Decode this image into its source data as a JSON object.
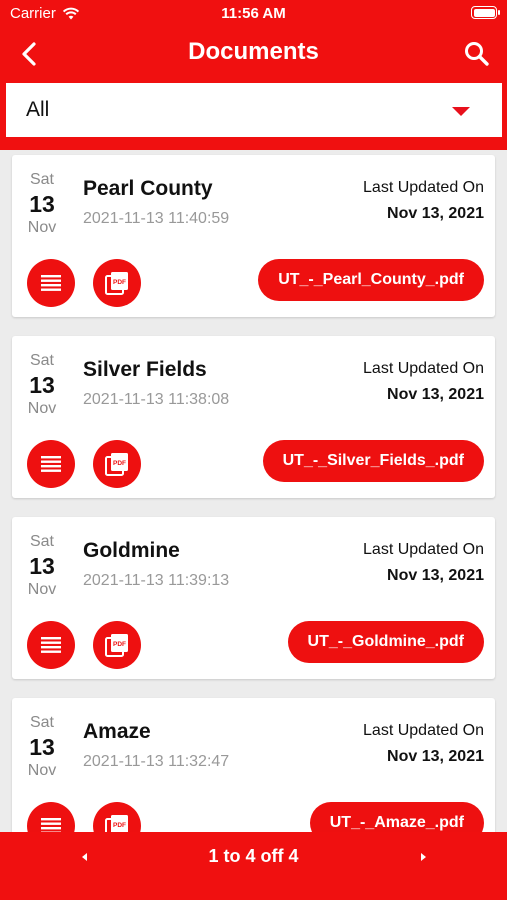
{
  "status": {
    "carrier": "Carrier",
    "time": "11:56 AM"
  },
  "nav": {
    "title": "Documents"
  },
  "filter": {
    "selected": "All"
  },
  "documents": [
    {
      "dow": "Sat",
      "day": "13",
      "month": "Nov",
      "name": "Pearl County",
      "timestamp": "2021-11-13 11:40:59",
      "updated_label": "Last Updated On",
      "updated_date": "Nov 13, 2021",
      "file": "UT_-_Pearl_County_.pdf"
    },
    {
      "dow": "Sat",
      "day": "13",
      "month": "Nov",
      "name": "Silver Fields",
      "timestamp": "2021-11-13 11:38:08",
      "updated_label": "Last Updated On",
      "updated_date": "Nov 13, 2021",
      "file": "UT_-_Silver_Fields_.pdf"
    },
    {
      "dow": "Sat",
      "day": "13",
      "month": "Nov",
      "name": "Goldmine",
      "timestamp": "2021-11-13 11:39:13",
      "updated_label": "Last Updated On",
      "updated_date": "Nov 13, 2021",
      "file": "UT_-_Goldmine_.pdf"
    },
    {
      "dow": "Sat",
      "day": "13",
      "month": "Nov",
      "name": "Amaze",
      "timestamp": "2021-11-13 11:32:47",
      "updated_label": "Last Updated On",
      "updated_date": "Nov 13, 2021",
      "file": "UT_-_Amaze_.pdf"
    }
  ],
  "pagination": {
    "text": "1 to 4 off 4"
  },
  "icons": {
    "back": "chevron-left-icon",
    "search": "search-icon",
    "dropdown": "caret-down-icon",
    "list": "list-icon",
    "pdf": "pdf-icon",
    "prev": "prev-arrow-icon",
    "next": "next-arrow-icon",
    "wifi": "wifi-icon",
    "battery": "battery-icon"
  },
  "colors": {
    "primary": "#f01010",
    "background": "#ececec",
    "card": "#ffffff"
  }
}
